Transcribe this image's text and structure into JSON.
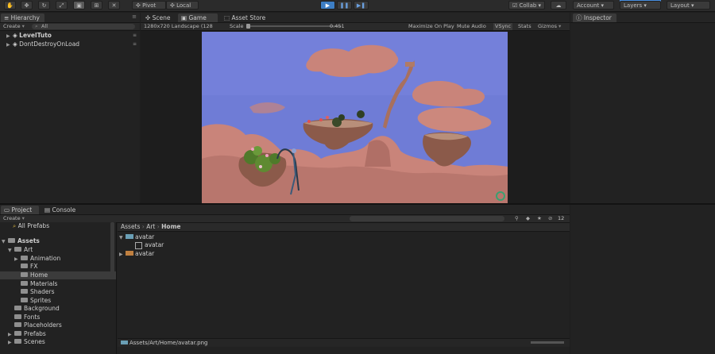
{
  "toolbar": {
    "pivot_label": "Pivot",
    "local_label": "Local",
    "collab_label": "Collab",
    "account_label": "Account",
    "layers_label": "Layers",
    "layout_label": "Layout"
  },
  "hierarchy": {
    "tab_label": "Hierarchy",
    "create_label": "Create",
    "search_placeholder": "All",
    "items": [
      {
        "label": "LevelTuto"
      },
      {
        "label": "DontDestroyOnLoad"
      }
    ]
  },
  "center": {
    "tabs": [
      {
        "label": "Scene"
      },
      {
        "label": "Game"
      },
      {
        "label": "Asset Store"
      }
    ],
    "resolution": "1280x720 Landscape (128",
    "scale_label": "Scale",
    "scale_value": "0.451",
    "maximize": "Maximize On Play",
    "mute": "Mute Audio",
    "vsync": "VSync",
    "stats": "Stats",
    "gizmos": "Gizmos"
  },
  "inspector": {
    "tab_label": "Inspector"
  },
  "project": {
    "tabs": [
      {
        "label": "Project"
      },
      {
        "label": "Console"
      }
    ],
    "create_label": "Create",
    "badge_count": "12",
    "tree": [
      {
        "label": "All Prefabs"
      },
      {
        "label": "Assets"
      },
      {
        "label": "Art"
      },
      {
        "label": "Animation"
      },
      {
        "label": "FX"
      },
      {
        "label": "Home"
      },
      {
        "label": "Materials"
      },
      {
        "label": "Shaders"
      },
      {
        "label": "Sprites"
      },
      {
        "label": "Background"
      },
      {
        "label": "Fonts"
      },
      {
        "label": "Placeholders"
      },
      {
        "label": "Prefabs"
      },
      {
        "label": "Scenes"
      }
    ],
    "breadcrumb": [
      "Assets",
      "Art",
      "Home"
    ],
    "files": [
      {
        "label": "avatar"
      },
      {
        "label": "avatar"
      },
      {
        "label": "avatar"
      }
    ],
    "status_path": "Assets/Art/Home/avatar.png"
  },
  "colors": {
    "sky": "#6f7cd6",
    "cloud": "#c9847a",
    "rock": "#8b5a4a",
    "accent": "#3d7ec4"
  }
}
